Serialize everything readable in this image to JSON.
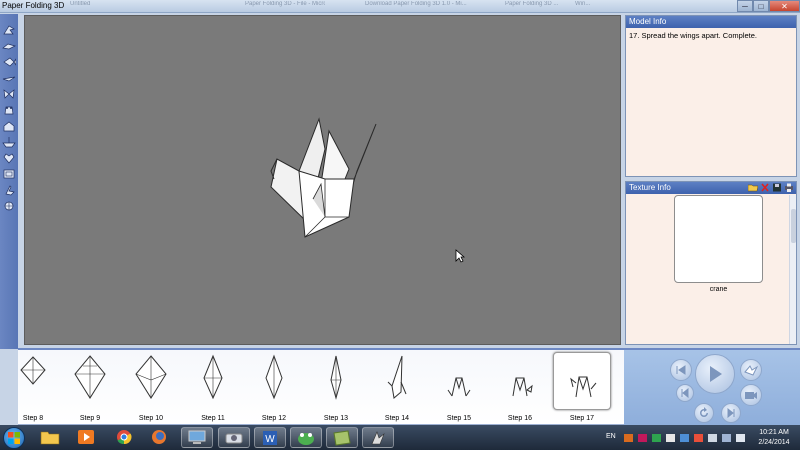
{
  "window": {
    "title": "Paper Folding 3D",
    "background_tabs": [
      "Untitled",
      "Paper Folding 3D - File - Microsoft...",
      "Download Paper Folding 3D 1.0 - Mi...",
      "Paper Folding 3D ...",
      "Win..."
    ],
    "controls": {
      "minimize": "─",
      "maximize": "□",
      "close": "✕"
    }
  },
  "toolbar": {
    "tools": [
      "crane-tool-icon",
      "bird-tool-icon",
      "fish-tool-icon",
      "plane-tool-icon",
      "butterfly-tool-icon",
      "frog-tool-icon",
      "house-tool-icon",
      "boat-tool-icon",
      "heart-tool-icon",
      "box-tool-icon",
      "swan-tool-icon",
      "flower-tool-icon"
    ]
  },
  "viewport": {
    "background": "#7a7a7a"
  },
  "model_info": {
    "header": "Model Info",
    "text": "17. Spread the wings apart. Complete."
  },
  "texture_info": {
    "header": "Texture Info",
    "label": "crane",
    "icons": [
      "open-folder-icon",
      "delete-icon",
      "save-icon",
      "print-icon"
    ]
  },
  "steps": [
    {
      "label": "Step 8"
    },
    {
      "label": "Step 9"
    },
    {
      "label": "Step 10"
    },
    {
      "label": "Step 11"
    },
    {
      "label": "Step 12"
    },
    {
      "label": "Step 13"
    },
    {
      "label": "Step 14"
    },
    {
      "label": "Step 15"
    },
    {
      "label": "Step 16"
    },
    {
      "label": "Step 17",
      "selected": true
    }
  ],
  "playback": {
    "buttons": [
      "previous-step-icon",
      "play-icon",
      "first-step-icon",
      "next-step-icon",
      "replay-icon",
      "last-step-icon",
      "bird-icon",
      "camera-icon"
    ]
  },
  "taskbar": {
    "apps": [
      "file-explorer-icon",
      "media-player-icon",
      "chrome-icon",
      "firefox-icon",
      "computer-icon",
      "scanner-icon",
      "word-icon",
      "frog-app-icon",
      "paper-app-icon",
      "crane-app-icon"
    ],
    "language": "EN",
    "time": "10:21 AM",
    "date": "2/24/2014"
  },
  "colors": {
    "accent": "#4a6fb8",
    "panel_bg": "#fbefe8",
    "viewport_bg": "#7a7a7a",
    "taskbar": "#25344a"
  }
}
